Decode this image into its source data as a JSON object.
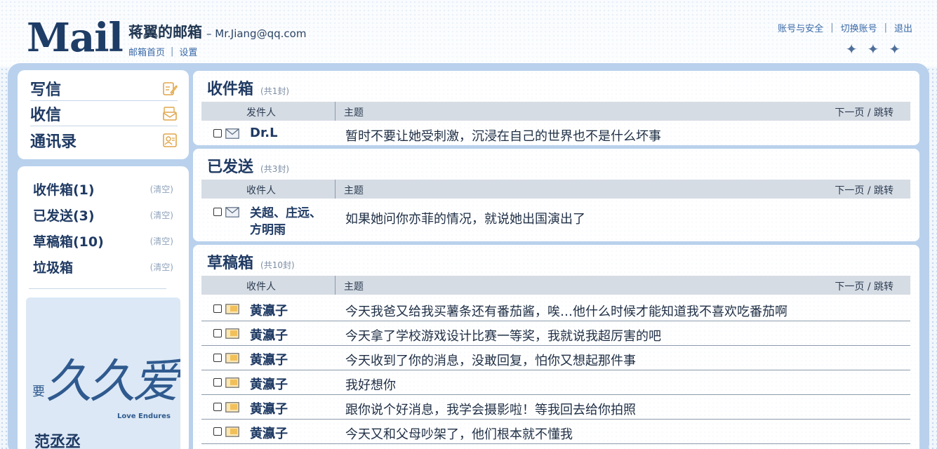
{
  "header": {
    "logo": "Mail",
    "owner_name": "蒋翼的邮箱",
    "owner_email": "– Mr.Jiang@qq.com",
    "links": [
      "邮箱首页",
      "设置"
    ],
    "separator": "|",
    "top_right_links": [
      "账号与安全",
      "切换账号",
      "退出"
    ],
    "sparkle": "✦"
  },
  "sidebar": {
    "nav": [
      {
        "label": "写信",
        "icon": "compose-icon"
      },
      {
        "label": "收信",
        "icon": "receive-mail-icon"
      },
      {
        "label": "通讯录",
        "icon": "contacts-icon"
      }
    ],
    "folders": [
      {
        "label": "收件箱(1)",
        "clear": "(清空)"
      },
      {
        "label": "已发送(3)",
        "clear": "(清空)"
      },
      {
        "label": "草稿箱(10)",
        "clear": "(清空)"
      },
      {
        "label": "垃圾箱",
        "clear": "(清空)"
      }
    ],
    "promo": {
      "small": "要",
      "big": "久久爱",
      "english": "Love Endures",
      "name": "范丞丞"
    }
  },
  "inbox": {
    "title": "收件箱",
    "count": "(共1封)",
    "col_who": "发件人",
    "col_subject": "主题",
    "pager": "下一页 / 跳转",
    "rows": [
      {
        "who": "Dr.L",
        "subject": "暂时不要让她受刺激，沉浸在自己的世界也不是什么坏事"
      }
    ]
  },
  "sent": {
    "title": "已发送",
    "count": "(共3封)",
    "col_who": "收件人",
    "col_subject": "主题",
    "pager": "下一页 / 跳转",
    "rows": [
      {
        "who_line1": "关超、庄远、",
        "who_line2": "方明雨",
        "subject": "如果她问你亦菲的情况，就说她出国演出了"
      }
    ]
  },
  "drafts": {
    "title": "草稿箱",
    "count": "(共10封)",
    "col_who": "收件人",
    "col_subject": "主题",
    "pager": "下一页 / 跳转",
    "rows": [
      {
        "who": "黄瀛子",
        "subject": "今天我爸又给我买薯条还有番茄酱，唉…他什么时候才能知道我不喜欢吃番茄啊"
      },
      {
        "who": "黄瀛子",
        "subject": "今天拿了学校游戏设计比赛一等奖，我就说我超厉害的吧"
      },
      {
        "who": "黄瀛子",
        "subject": "今天收到了你的消息，没敢回复，怕你又想起那件事"
      },
      {
        "who": "黄瀛子",
        "subject": "我好想你"
      },
      {
        "who": "黄瀛子",
        "subject": "跟你说个好消息，我学会摄影啦！等我回去给你拍照"
      },
      {
        "who": "黄瀛子",
        "subject": "今天又和父母吵架了，他们根本就不懂我"
      }
    ]
  },
  "colors": {
    "frame": "#b9d1ec",
    "accent": "#1f3a63",
    "link": "#3a6aa8",
    "header_bar": "#d6dce4"
  }
}
